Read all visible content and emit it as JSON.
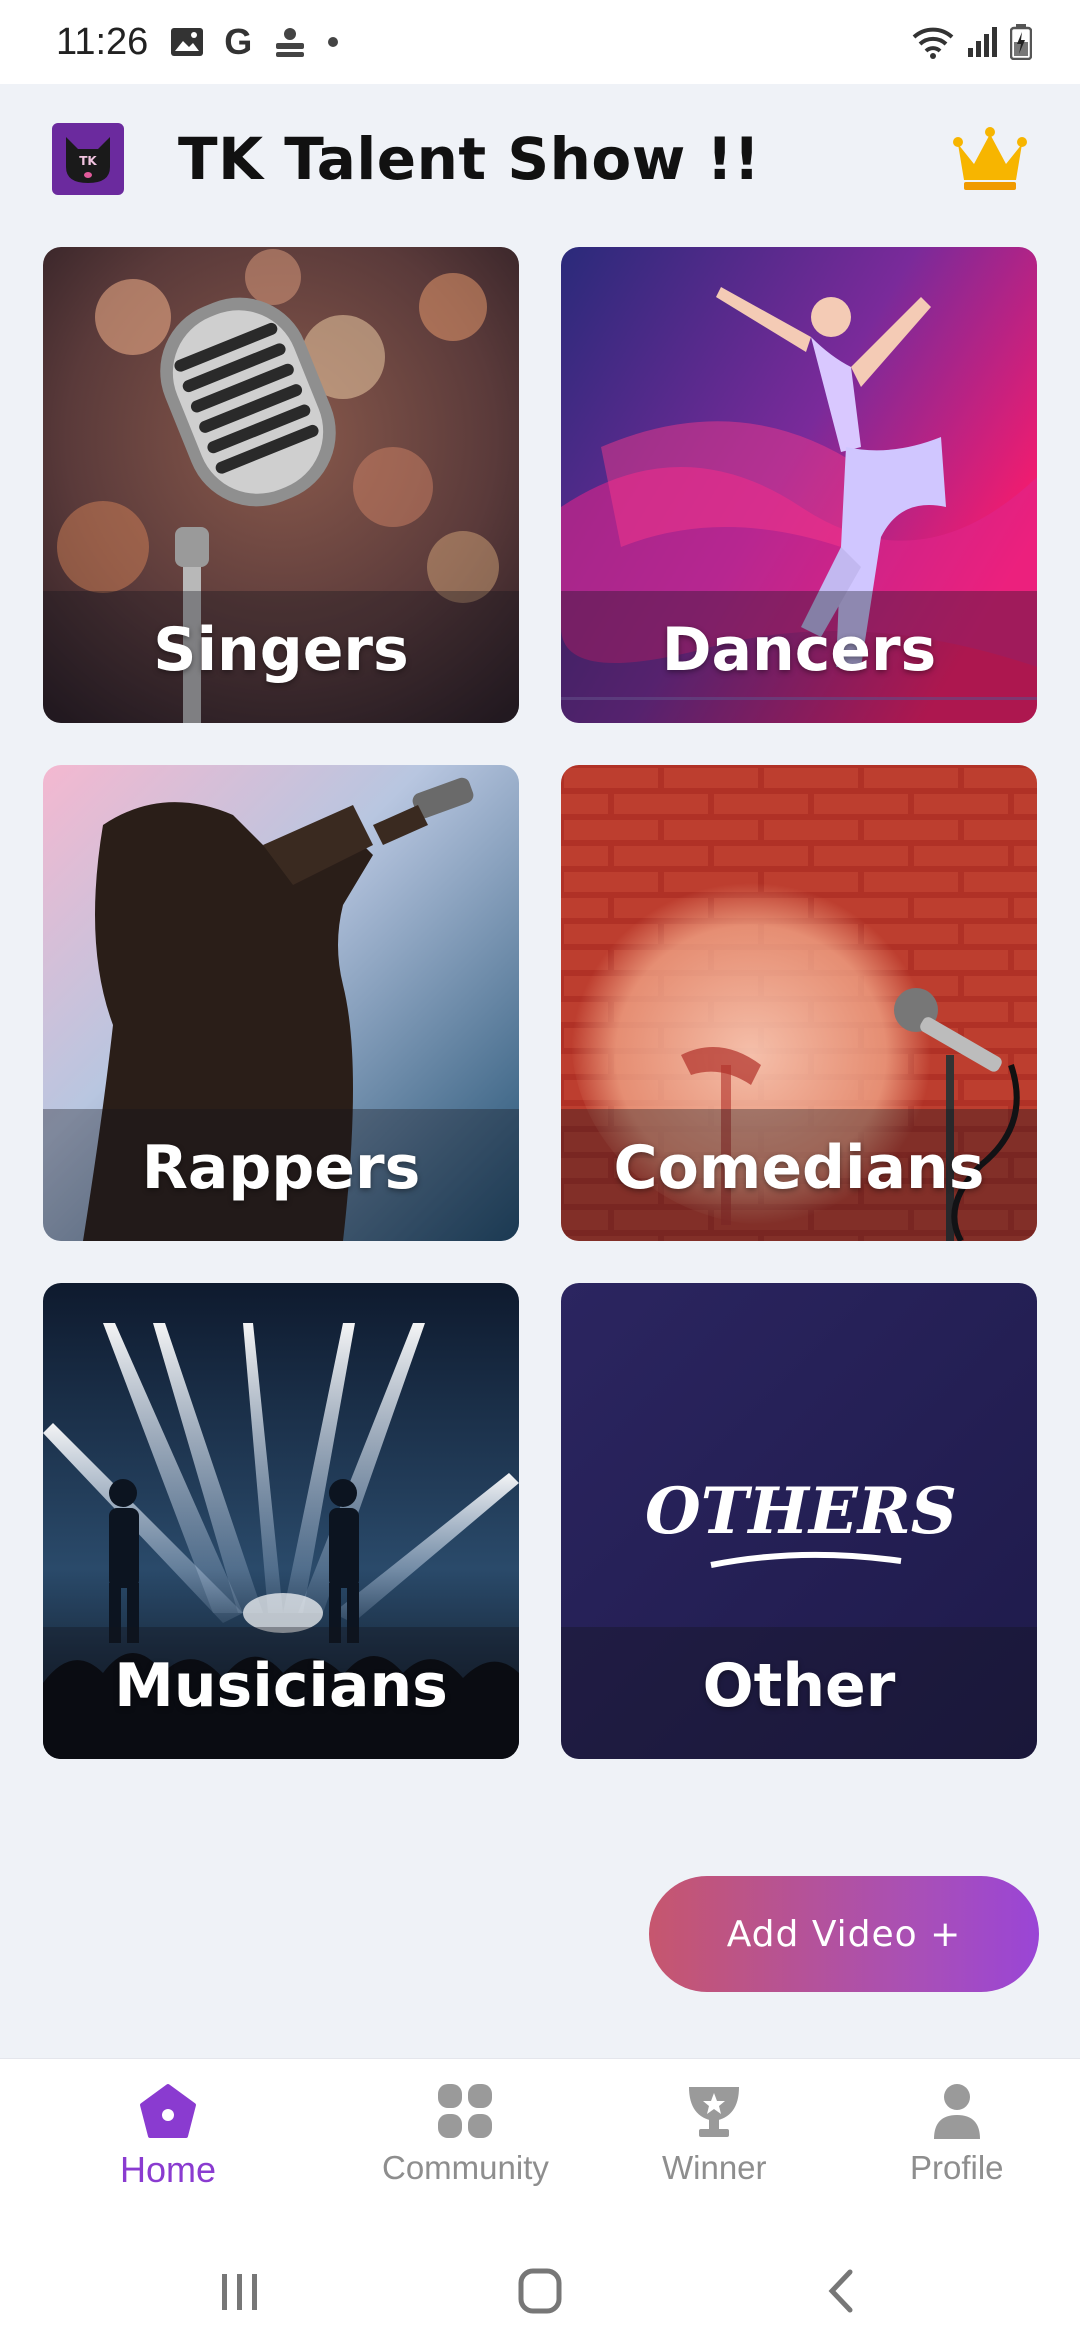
{
  "status_bar": {
    "time": "11:26",
    "left_icons": [
      "image-icon",
      "google-icon",
      "app-notification-icon",
      "dot-icon"
    ],
    "right_icons": [
      "wifi-icon",
      "signal-icon",
      "battery-charging-icon"
    ]
  },
  "app_bar": {
    "logo_text": "TK",
    "title": "TK Talent Show !!",
    "crown_color": "#f5a800"
  },
  "categories": [
    {
      "label": "Singers"
    },
    {
      "label": "Dancers"
    },
    {
      "label": "Rappers"
    },
    {
      "label": "Comedians"
    },
    {
      "label": "Musicians"
    },
    {
      "label": "Other",
      "art_text": "OTHERS"
    }
  ],
  "add_video": {
    "label": "Add Video +"
  },
  "bottom_nav": {
    "items": [
      {
        "label": "Home",
        "icon": "home-icon",
        "active": true
      },
      {
        "label": "Community",
        "icon": "grid-icon",
        "active": false
      },
      {
        "label": "Winner",
        "icon": "trophy-icon",
        "active": false
      },
      {
        "label": "Profile",
        "icon": "person-icon",
        "active": false
      }
    ],
    "active_color": "#8a3bd0",
    "inactive_color": "#8e8e8e"
  },
  "system_nav": [
    "recents-icon",
    "home-circle-icon",
    "back-icon"
  ]
}
